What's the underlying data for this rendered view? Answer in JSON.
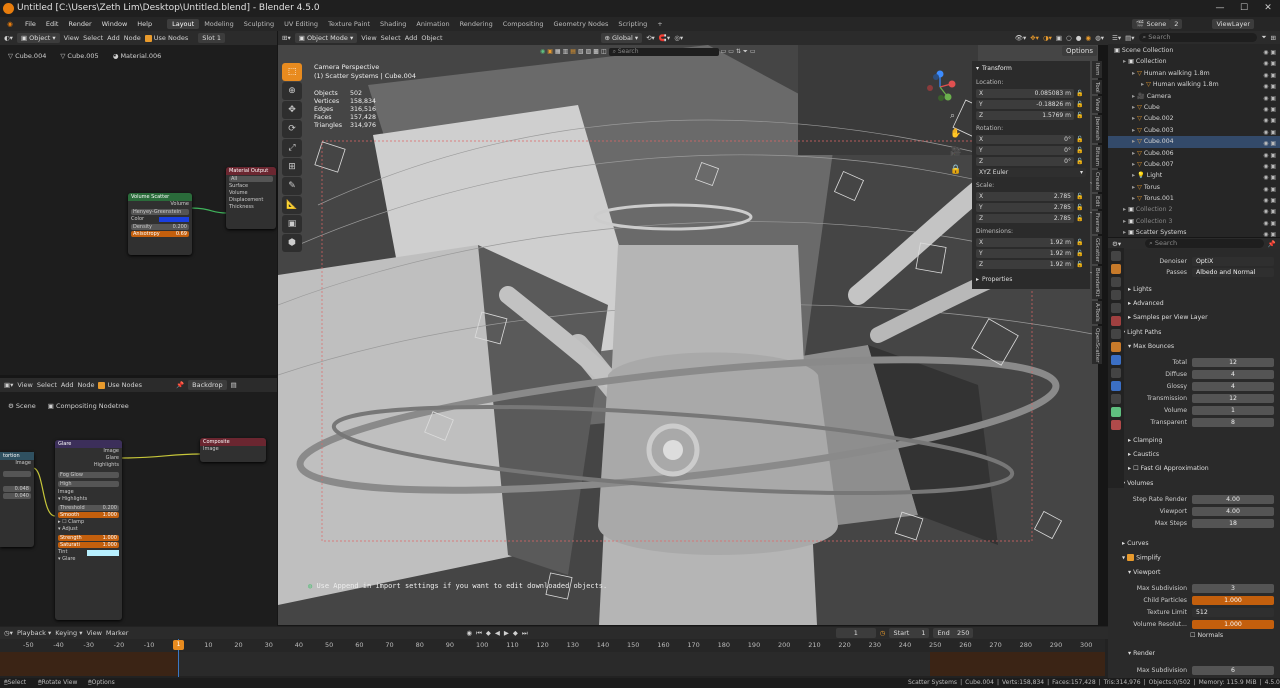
{
  "window": {
    "title": "Untitled [C:\\Users\\Zeth Lim\\Desktop\\Untitled.blend] - Blender 4.5.0"
  },
  "menu": {
    "file": "File",
    "edit": "Edit",
    "render": "Render",
    "window": "Window",
    "help": "Help"
  },
  "workspaces": [
    "Layout",
    "Modeling",
    "Sculpting",
    "UV Editing",
    "Texture Paint",
    "Shading",
    "Animation",
    "Rendering",
    "Compositing",
    "Geometry Nodes",
    "Scripting"
  ],
  "topright": {
    "scene": "Scene",
    "view_layer": "ViewLayer",
    "num": "2"
  },
  "shader_editor": {
    "header": {
      "type": "Object",
      "view": "View",
      "select": "Select",
      "add": "Add",
      "node": "Node",
      "use_nodes": "Use Nodes",
      "slot": "Slot 1"
    },
    "breadcrumb": [
      "Cube.004",
      "Cube.005",
      "Material.006"
    ],
    "volume_scatter": {
      "title": "Volume Scatter",
      "output": "Volume",
      "phase": "Henyey-Greenstein",
      "color": "Color",
      "density_label": "Density",
      "density": "0.200",
      "anisotropy_label": "Anisotropy",
      "anisotropy": "0.69"
    },
    "material_output": {
      "title": "Material Output",
      "target": "All",
      "surface": "Surface",
      "volume": "Volume",
      "displacement": "Displacement",
      "thickness": "Thickness"
    }
  },
  "compositor": {
    "header": {
      "view": "View",
      "select": "Select",
      "add": "Add",
      "node": "Node",
      "use_nodes": "Use Nodes",
      "backdrop": "Backdrop"
    },
    "breadcrumb": [
      "Scene",
      "Compositing Nodetree"
    ],
    "distortion": {
      "title": "tortion",
      "output": "Image",
      "v1": "0.048",
      "v2": "0.040"
    },
    "glare": {
      "title": "Glare",
      "out_image": "Image",
      "out_glare": "Glare",
      "out_highlights": "Highlights",
      "type": "Fog Glow",
      "quality": "High",
      "in_image": "Image",
      "highlights": "Highlights",
      "threshold_label": "Threshold",
      "threshold": "0.200",
      "smooth_label": "Smooth",
      "smooth": "1.000",
      "clamp": "Clamp",
      "adjust": "Adjust",
      "strength_label": "Strength",
      "strength": "1.000",
      "saturation_label": "Saturati",
      "saturation": "1.000",
      "tint": "Tint",
      "glare_sec": "Glare"
    },
    "composite": {
      "title": "Composite",
      "in_image": "Image"
    }
  },
  "viewport": {
    "header": {
      "mode": "Object Mode",
      "view": "View",
      "select": "Select",
      "add": "Add",
      "object": "Object",
      "orientation": "Global",
      "options": "Options",
      "search": "Search"
    },
    "camera_label": "Camera Perspective",
    "object_label": "(1) Scatter Systems | Cube.004",
    "stats": [
      {
        "k": "Objects",
        "v": "502"
      },
      {
        "k": "Vertices",
        "v": "158,834"
      },
      {
        "k": "Edges",
        "v": "316,516"
      },
      {
        "k": "Faces",
        "v": "157,428"
      },
      {
        "k": "Triangles",
        "v": "314,976"
      }
    ],
    "hint": "Use Append in import settings if you want to edit downloaded objects.",
    "gizmo": {
      "x": "X",
      "y": "Y",
      "z": "Z"
    }
  },
  "npanel": {
    "title": "Transform",
    "location": "Location:",
    "loc": [
      {
        "a": "X",
        "v": "0.085083 m"
      },
      {
        "a": "Y",
        "v": "-0.18826 m"
      },
      {
        "a": "Z",
        "v": "1.5769 m"
      }
    ],
    "rotation": "Rotation:",
    "rot": [
      {
        "a": "X",
        "v": "0°"
      },
      {
        "a": "Y",
        "v": "0°"
      },
      {
        "a": "Z",
        "v": "0°"
      }
    ],
    "mode": "XYZ Euler",
    "scale": "Scale:",
    "scl": [
      {
        "a": "X",
        "v": "2.785"
      },
      {
        "a": "Y",
        "v": "2.785"
      },
      {
        "a": "Z",
        "v": "2.785"
      }
    ],
    "dimensions": "Dimensions:",
    "dim": [
      {
        "a": "X",
        "v": "1.92 m"
      },
      {
        "a": "Y",
        "v": "1.92 m"
      },
      {
        "a": "Z",
        "v": "1.92 m"
      }
    ],
    "properties": "Properties"
  },
  "ntabs": [
    "Item",
    "Tool",
    "View",
    "Jbemesh",
    "Bitsam",
    "Create",
    "Edit",
    "Fiverse",
    "GScatter",
    "BlenderKit",
    "A-Tools",
    "OpenScatter"
  ],
  "outliner": {
    "search": "Search",
    "rows": [
      {
        "label": "Scene Collection",
        "indent": 0
      },
      {
        "label": "Collection",
        "indent": 1
      },
      {
        "label": "Human walking 1.8m",
        "indent": 2
      },
      {
        "label": "Human walking 1.8m",
        "indent": 3
      },
      {
        "label": "Camera",
        "indent": 2
      },
      {
        "label": "Cube",
        "indent": 2
      },
      {
        "label": "Cube.002",
        "indent": 2
      },
      {
        "label": "Cube.003",
        "indent": 2
      },
      {
        "label": "Cube.004",
        "indent": 2
      },
      {
        "label": "Cube.006",
        "indent": 2
      },
      {
        "label": "Cube.007",
        "indent": 2
      },
      {
        "label": "Light",
        "indent": 2
      },
      {
        "label": "Torus",
        "indent": 2
      },
      {
        "label": "Torus.001",
        "indent": 2
      },
      {
        "label": "Collection 2",
        "indent": 1
      },
      {
        "label": "Collection 3",
        "indent": 1
      },
      {
        "label": "Scatter Systems",
        "indent": 1
      }
    ]
  },
  "properties": {
    "search": "Search",
    "denoiser_label": "Denoiser",
    "denoiser": "OptiX",
    "passes_label": "Passes",
    "passes": "Albedo and Normal",
    "lights": "Lights",
    "advanced": "Advanced",
    "samples_per_layer": "Samples per View Layer",
    "light_paths": "Light Paths",
    "max_bounces": "Max Bounces",
    "bounces": [
      {
        "k": "Total",
        "v": "12"
      },
      {
        "k": "Diffuse",
        "v": "4"
      },
      {
        "k": "Glossy",
        "v": "4"
      },
      {
        "k": "Transmission",
        "v": "12"
      },
      {
        "k": "Volume",
        "v": "1"
      },
      {
        "k": "Transparent",
        "v": "8"
      }
    ],
    "clamping": "Clamping",
    "caustics": "Caustics",
    "fast_gi": "Fast GI Approximation",
    "volumes": "Volumes",
    "vol": [
      {
        "k": "Step Rate Render",
        "v": "4.00"
      },
      {
        "k": "Viewport",
        "v": "4.00"
      },
      {
        "k": "Max Steps",
        "v": "18"
      }
    ],
    "curves": "Curves",
    "simplify": "Simplify",
    "viewport_sec": "Viewport",
    "max_subdiv_label": "Max Subdivision",
    "max_subdiv": "3",
    "child_particles_label": "Child Particles",
    "child_particles": "1.000",
    "texture_limit_label": "Texture Limit",
    "texture_limit": "512",
    "volume_res_label": "Volume Resolut...",
    "volume_res": "1.000",
    "normals": "Normals",
    "render_sec": "Render",
    "render_max_subdiv_label": "Max Subdivision",
    "render_max_subdiv": "6"
  },
  "timeline": {
    "playback": "Playback",
    "keying": "Keying",
    "view": "View",
    "marker": "Marker",
    "current": "1",
    "start_label": "Start",
    "start": "1",
    "end_label": "End",
    "end": "250",
    "ticks": [
      "-50",
      "-40",
      "-30",
      "-20",
      "-10",
      "0",
      "10",
      "20",
      "30",
      "40",
      "50",
      "60",
      "70",
      "80",
      "90",
      "100",
      "110",
      "120",
      "130",
      "140",
      "150",
      "160",
      "170",
      "180",
      "190",
      "200",
      "210",
      "220",
      "230",
      "240",
      "250",
      "260",
      "270",
      "280",
      "290",
      "300"
    ],
    "playhead": "1"
  },
  "statusbar": {
    "select": "Select",
    "rotate": "Rotate View",
    "options": "Options",
    "scene": "Scatter Systems",
    "obj": "Cube.004",
    "verts": "Verts:158,834",
    "faces": "Faces:157,428",
    "tris": "Tris:314,976",
    "objects": "Objects:0/502",
    "memory": "Memory: 115.9 MiB",
    "version": "4.5.0"
  },
  "colors": {
    "accent": "#e88b1f",
    "node_green": "#2a6b3a",
    "node_red": "#6b2630",
    "node_purple": "#3c2f5a"
  }
}
